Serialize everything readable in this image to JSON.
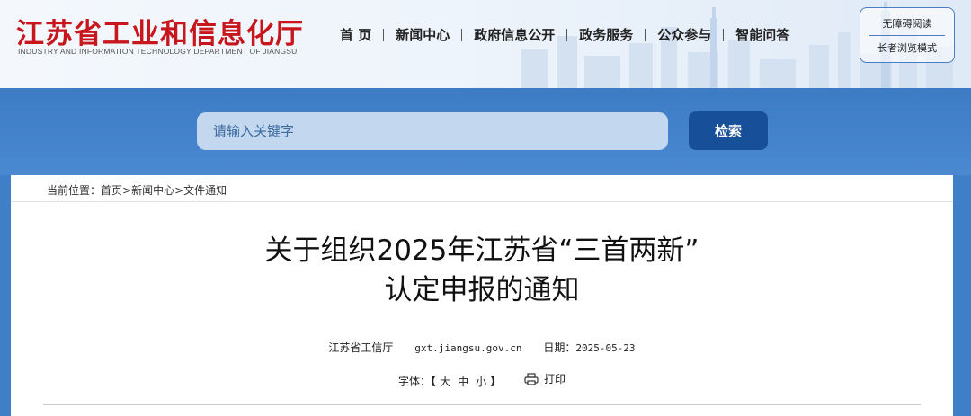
{
  "header": {
    "title": "江苏省工业和信息化厅",
    "subtitle": "INDUSTRY AND INFORMATION TECHNOLOGY DEPARTMENT OF JIANGSU",
    "nav": [
      "首 页",
      "新闻中心",
      "政府信息公开",
      "政务服务",
      "公众参与",
      "智能问答"
    ],
    "accessibility": {
      "barrier_free": "无障碍阅读",
      "elder_mode": "长者浏览模式"
    }
  },
  "search": {
    "placeholder": "请输入关键字",
    "button": "检索"
  },
  "breadcrumb": {
    "prefix": "当前位置：",
    "items": [
      "首页",
      "新闻中心",
      "文件通知"
    ],
    "separator": ">"
  },
  "article": {
    "title_line1": "关于组织2025年江苏省“三首两新”",
    "title_line2": "认定申报的通知",
    "source": "江苏省工信厅",
    "site": "gxt.jiangsu.gov.cn",
    "date_label": "日期：",
    "date": "2025-05-23"
  },
  "tools": {
    "font_label": "字体：",
    "bracket_open": "【",
    "sizes": [
      "大",
      "中",
      "小"
    ],
    "bracket_close": "】",
    "print_label": "打印"
  },
  "colors": {
    "title_red": "#c8161d",
    "band_blue": "#3f7fc8",
    "button_blue": "#174f98"
  }
}
